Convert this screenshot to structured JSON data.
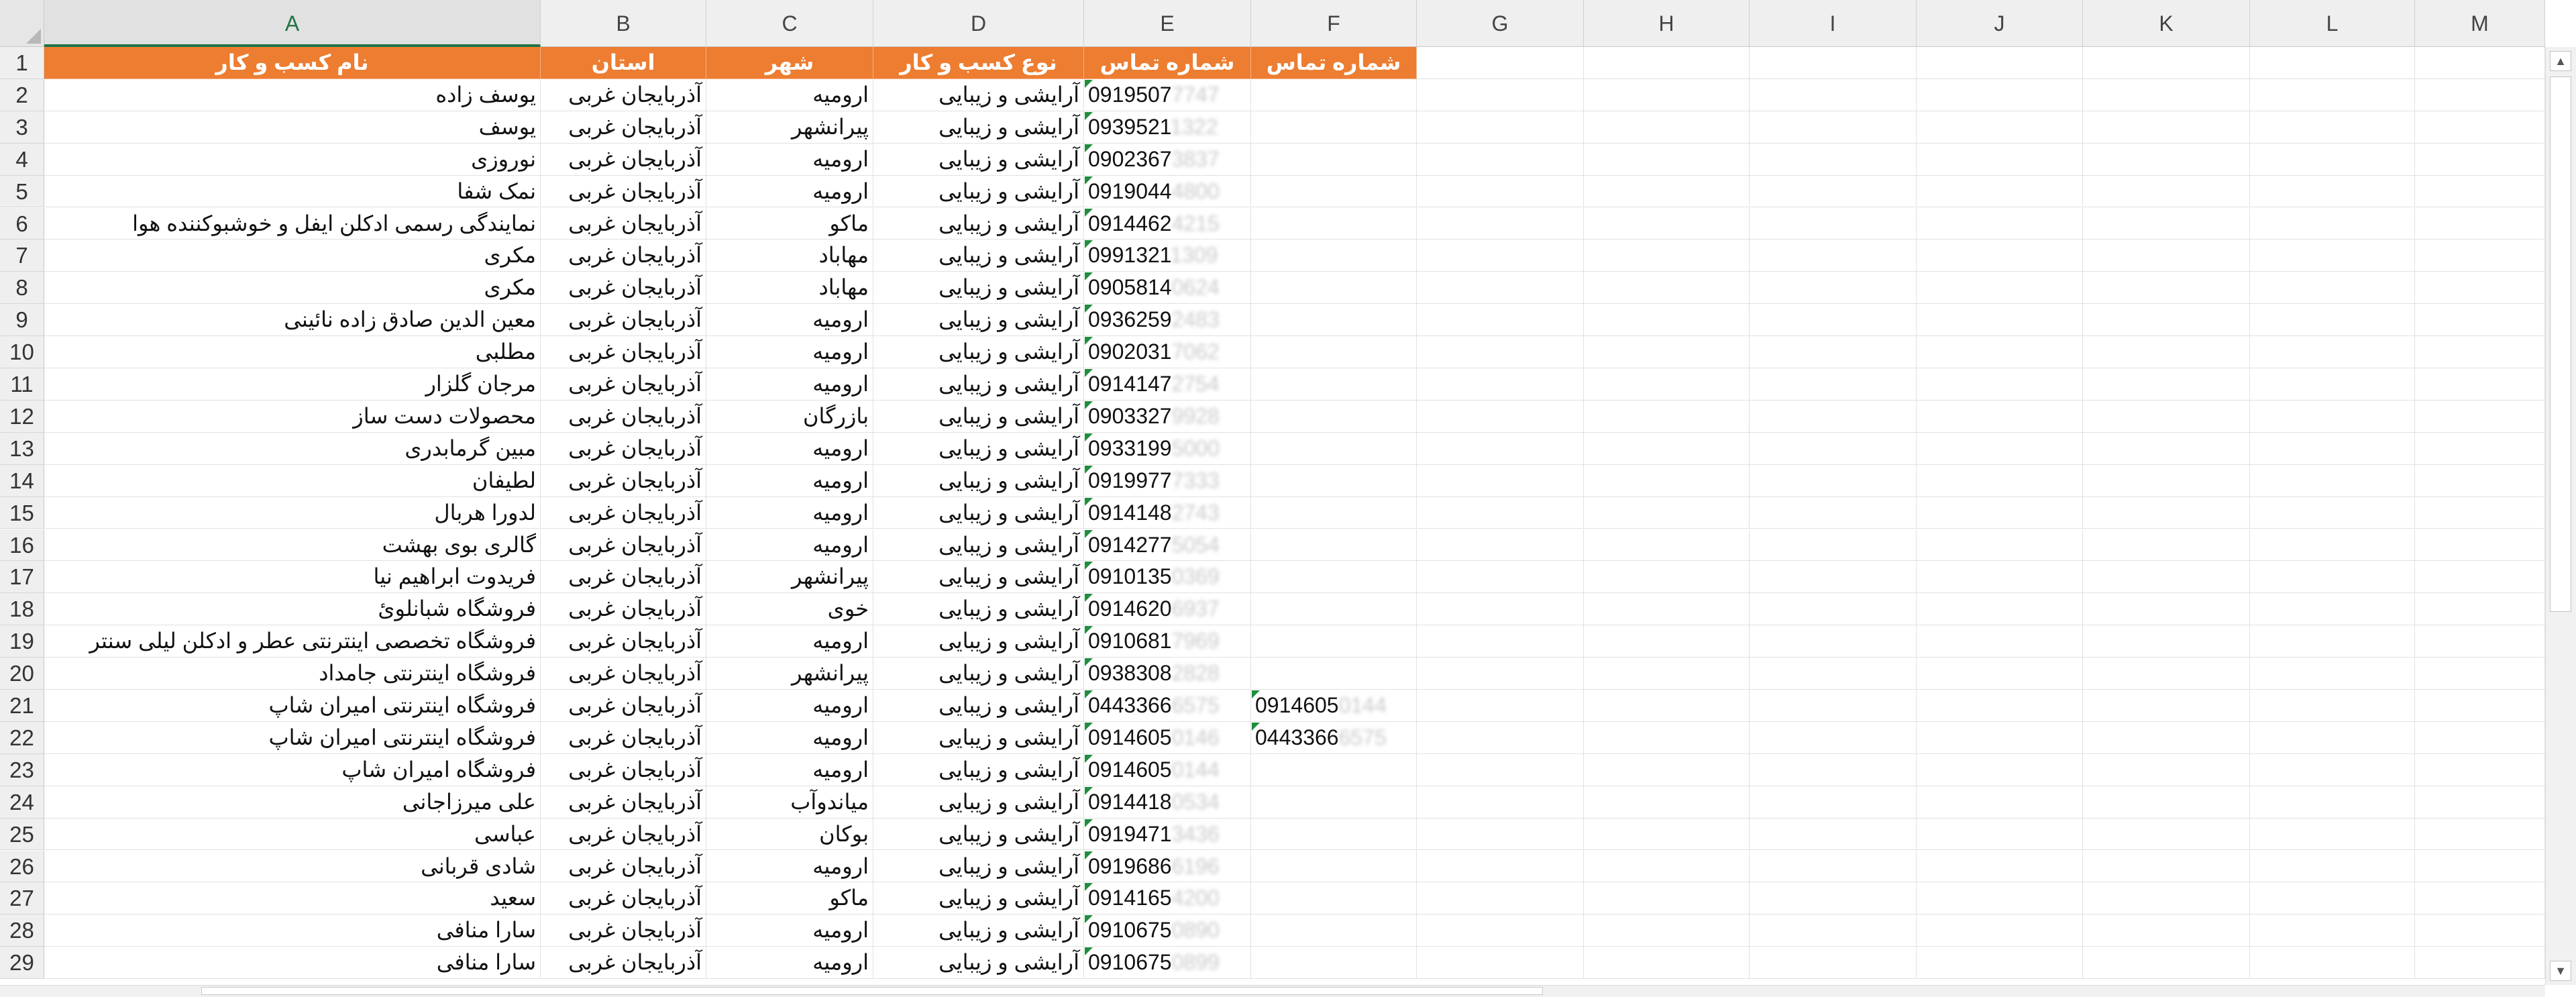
{
  "columns": [
    "A",
    "B",
    "C",
    "D",
    "E",
    "F",
    "G",
    "H",
    "I",
    "J",
    "K",
    "L",
    "M"
  ],
  "selected_column": "A",
  "headers": {
    "A": "نام کسب و کار",
    "B": "استان",
    "C": "شهر",
    "D": "نوع کسب و کار",
    "E": "شماره تماس",
    "F": "شماره تماس"
  },
  "rows": [
    {
      "n": "2",
      "a": "یوسف زاده",
      "b": "آذربایجان غربی",
      "c": "ارومیه",
      "d": "آرایشی و زیبایی",
      "e": "0919507",
      "e_blur": "7747",
      "f": "",
      "f_blur": ""
    },
    {
      "n": "3",
      "a": "یوسف",
      "b": "آذربایجان غربی",
      "c": "پیرانشهر",
      "d": "آرایشی و زیبایی",
      "e": "0939521",
      "e_blur": "1322",
      "f": "",
      "f_blur": ""
    },
    {
      "n": "4",
      "a": "نوروزی",
      "b": "آذربایجان غربی",
      "c": "ارومیه",
      "d": "آرایشی و زیبایی",
      "e": "0902367",
      "e_blur": "3837",
      "f": "",
      "f_blur": ""
    },
    {
      "n": "5",
      "a": "نمک شفا",
      "b": "آذربایجان غربی",
      "c": "ارومیه",
      "d": "آرایشی و زیبایی",
      "e": "0919044",
      "e_blur": "4800",
      "f": "",
      "f_blur": ""
    },
    {
      "n": "6",
      "a": "نمایندگی رسمی ادکلن ایفل و خوشبوکننده هوا",
      "b": "آذربایجان غربی",
      "c": "ماکو",
      "d": "آرایشی و زیبایی",
      "e": "0914462",
      "e_blur": "4215",
      "f": "",
      "f_blur": ""
    },
    {
      "n": "7",
      "a": "مکری",
      "b": "آذربایجان غربی",
      "c": "مهاباد",
      "d": "آرایشی و زیبایی",
      "e": "0991321",
      "e_blur": "1309",
      "f": "",
      "f_blur": ""
    },
    {
      "n": "8",
      "a": "مکری",
      "b": "آذربایجان غربی",
      "c": "مهاباد",
      "d": "آرایشی و زیبایی",
      "e": "0905814",
      "e_blur": "0624",
      "f": "",
      "f_blur": ""
    },
    {
      "n": "9",
      "a": "معین الدین صادق زاده نائینی",
      "b": "آذربایجان غربی",
      "c": "ارومیه",
      "d": "آرایشی و زیبایی",
      "e": "0936259",
      "e_blur": "2483",
      "f": "",
      "f_blur": ""
    },
    {
      "n": "10",
      "a": "مطلبی",
      "b": "آذربایجان غربی",
      "c": "ارومیه",
      "d": "آرایشی و زیبایی",
      "e": "0902031",
      "e_blur": "7062",
      "f": "",
      "f_blur": ""
    },
    {
      "n": "11",
      "a": "مرجان گلزار",
      "b": "آذربایجان غربی",
      "c": "ارومیه",
      "d": "آرایشی و زیبایی",
      "e": "0914147",
      "e_blur": "2754",
      "f": "",
      "f_blur": ""
    },
    {
      "n": "12",
      "a": "محصولات دست ساز",
      "b": "آذربایجان غربی",
      "c": "بازرگان",
      "d": "آرایشی و زیبایی",
      "e": "0903327",
      "e_blur": "9928",
      "f": "",
      "f_blur": ""
    },
    {
      "n": "13",
      "a": "مبین گرمابدری",
      "b": "آذربایجان غربی",
      "c": "ارومیه",
      "d": "آرایشی و زیبایی",
      "e": "0933199",
      "e_blur": "5000",
      "f": "",
      "f_blur": ""
    },
    {
      "n": "14",
      "a": "لطیفان",
      "b": "آذربایجان غربی",
      "c": "ارومیه",
      "d": "آرایشی و زیبایی",
      "e": "0919977",
      "e_blur": "7333",
      "f": "",
      "f_blur": ""
    },
    {
      "n": "15",
      "a": "لدورا هربال",
      "b": "آذربایجان غربی",
      "c": "ارومیه",
      "d": "آرایشی و زیبایی",
      "e": "0914148",
      "e_blur": "2743",
      "f": "",
      "f_blur": ""
    },
    {
      "n": "16",
      "a": "گالری بوی بهشت",
      "b": "آذربایجان غربی",
      "c": "ارومیه",
      "d": "آرایشی و زیبایی",
      "e": "0914277",
      "e_blur": "5054",
      "f": "",
      "f_blur": ""
    },
    {
      "n": "17",
      "a": "فریدوت ابراهیم نیا",
      "b": "آذربایجان غربی",
      "c": "پیرانشهر",
      "d": "آرایشی و زیبایی",
      "e": "0910135",
      "e_blur": "0369",
      "f": "",
      "f_blur": ""
    },
    {
      "n": "18",
      "a": "فروشگاه شبانلوئ",
      "b": "آذربایجان غربی",
      "c": "خوی",
      "d": "آرایشی و زیبایی",
      "e": "0914620",
      "e_blur": "6937",
      "f": "",
      "f_blur": ""
    },
    {
      "n": "19",
      "a": "فروشگاه تخصصی اینترنتی عطر و ادکلن لیلی سنتر",
      "b": "آذربایجان غربی",
      "c": "ارومیه",
      "d": "آرایشی و زیبایی",
      "e": "0910681",
      "e_blur": "7969",
      "f": "",
      "f_blur": ""
    },
    {
      "n": "20",
      "a": "فروشگاه اینترنتی جامداد",
      "b": "آذربایجان غربی",
      "c": "پیرانشهر",
      "d": "آرایشی و زیبایی",
      "e": "0938308",
      "e_blur": "2828",
      "f": "",
      "f_blur": ""
    },
    {
      "n": "21",
      "a": "فروشگاه اینترنتی امیران شاپ",
      "b": "آذربایجان غربی",
      "c": "ارومیه",
      "d": "آرایشی و زیبایی",
      "e": "0443366",
      "e_blur": "6575",
      "f": "0914605",
      "f_blur": "0144"
    },
    {
      "n": "22",
      "a": "فروشگاه اینترنتی امیران شاپ",
      "b": "آذربایجان غربی",
      "c": "ارومیه",
      "d": "آرایشی و زیبایی",
      "e": "0914605",
      "e_blur": "0146",
      "f": "0443366",
      "f_blur": "6575"
    },
    {
      "n": "23",
      "a": "فروشگاه امیران شاپ",
      "b": "آذربایجان غربی",
      "c": "ارومیه",
      "d": "آرایشی و زیبایی",
      "e": "0914605",
      "e_blur": "0144",
      "f": "",
      "f_blur": ""
    },
    {
      "n": "24",
      "a": "علی میرزاجانی",
      "b": "آذربایجان غربی",
      "c": "میاندوآب",
      "d": "آرایشی و زیبایی",
      "e": "0914418",
      "e_blur": "0534",
      "f": "",
      "f_blur": ""
    },
    {
      "n": "25",
      "a": "عباسی",
      "b": "آذربایجان غربی",
      "c": "بوکان",
      "d": "آرایشی و زیبایی",
      "e": "0919471",
      "e_blur": "3436",
      "f": "",
      "f_blur": ""
    },
    {
      "n": "26",
      "a": "شادی قربانی",
      "b": "آذربایجان غربی",
      "c": "ارومیه",
      "d": "آرایشی و زیبایی",
      "e": "0919686",
      "e_blur": "6196",
      "f": "",
      "f_blur": ""
    },
    {
      "n": "27",
      "a": "سعید",
      "b": "آذربایجان غربی",
      "c": "ماکو",
      "d": "آرایشی و زیبایی",
      "e": "0914165",
      "e_blur": "4200",
      "f": "",
      "f_blur": ""
    },
    {
      "n": "28",
      "a": "سارا منافی",
      "b": "آذربایجان غربی",
      "c": "ارومیه",
      "d": "آرایشی و زیبایی",
      "e": "0910675",
      "e_blur": "0890",
      "f": "",
      "f_blur": ""
    },
    {
      "n": "29",
      "a": "سارا منافی",
      "b": "آذربایجان غربی",
      "c": "ارومیه",
      "d": "آرایشی و زیبایی",
      "e": "0910675",
      "e_blur": "0899",
      "f": "",
      "f_blur": ""
    }
  ],
  "colors": {
    "header_fill": "#ed7d31",
    "header_text": "#ffffff",
    "selected_column_accent": "#217346",
    "error_indicator": "#1e8e3e"
  },
  "icons": {
    "select_all": "select-all-triangle-icon",
    "scroll_up": "scroll-up-arrow-icon",
    "scroll_down": "scroll-down-arrow-icon",
    "error_indicator": "number-stored-as-text-indicator-icon"
  }
}
